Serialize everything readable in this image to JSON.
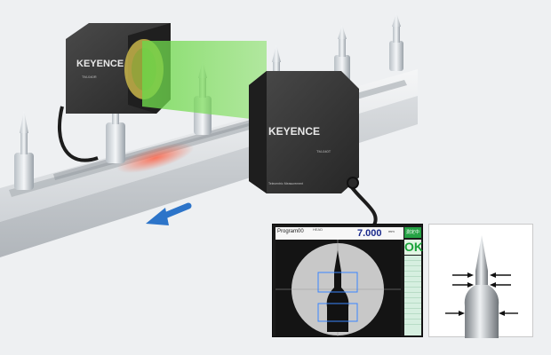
{
  "brand": {
    "name_rear": "KEYENCE",
    "name_front": "KEYENCE",
    "model_rear": "TM-040R",
    "model_front": "TM-040T",
    "series_front": "Telecentric Measurement"
  },
  "monitor": {
    "program": "Program00",
    "small_label": "HEAD",
    "value": "7.000",
    "unit": "mm",
    "status": "測定中",
    "judgement": "OK"
  },
  "colors": {
    "beam": "#6dd84a",
    "arrow_blue": "#2c74c9",
    "ok_green": "#25a244",
    "sensor_body": "#353535",
    "roi_blue": "#3a86ff"
  },
  "icons": {
    "direction_arrow": "arrow-left-down-icon",
    "measure_arrows": "arrow-right-icon"
  }
}
